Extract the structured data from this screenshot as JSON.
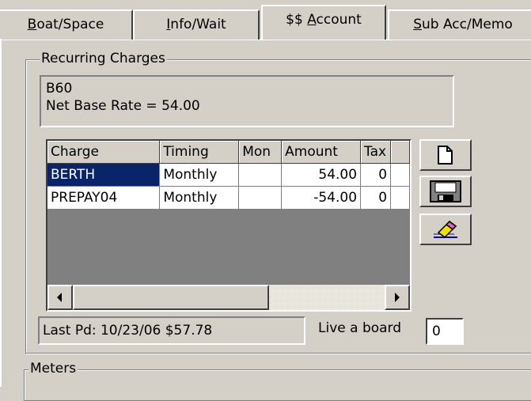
{
  "tabs": [
    {
      "label": "Boat/Space",
      "accel": "B",
      "rest": "oat/Space"
    },
    {
      "label": "Info/Wait",
      "accel": "I",
      "rest": "nfo/Wait"
    },
    {
      "label": "$$ Account",
      "pre": "$$ ",
      "accel": "A",
      "rest": "ccount"
    },
    {
      "label": "Sub Acc/Memo",
      "accel": "S",
      "rest": "ub Acc/Memo"
    }
  ],
  "recurring": {
    "legend": "Recurring Charges",
    "info_line1": "B60",
    "info_line2": "Net Base Rate = 54.00"
  },
  "grid": {
    "columns": [
      "Charge",
      "Timing",
      "Mon",
      "Amount",
      "Tax",
      ""
    ],
    "rows": [
      {
        "charge": "BERTH",
        "timing": "Monthly",
        "mon": "",
        "amount": "54.00",
        "tax": "0"
      },
      {
        "charge": "PREPAY04",
        "timing": "Monthly",
        "mon": "",
        "amount": "-54.00",
        "tax": "0"
      }
    ]
  },
  "toolbar": {
    "new_icon": "new-document-icon",
    "save_icon": "save-disk-icon",
    "erase_icon": "eraser-icon"
  },
  "footer": {
    "last_paid": "Last Pd: 10/23/06 $57.78",
    "live_aboard_label": "Live a board",
    "live_aboard_value": "0"
  },
  "meters": {
    "legend": "Meters"
  },
  "colors": {
    "face": "#d4d0c8",
    "selection": "#0a246a",
    "grid_bg": "#808080"
  }
}
